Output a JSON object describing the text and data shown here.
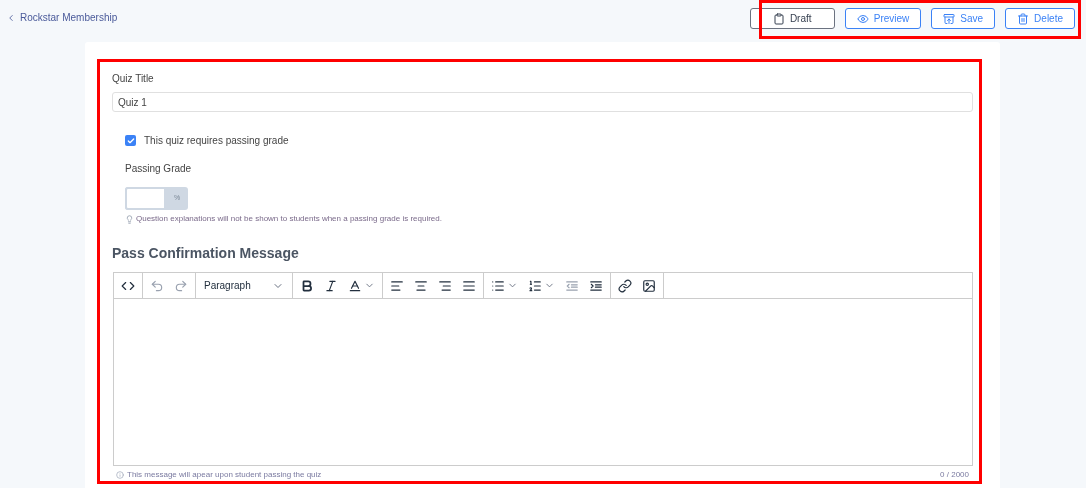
{
  "breadcrumb": {
    "label": "Rockstar Membership"
  },
  "actions": [
    {
      "label": "Draft",
      "kind": "draft"
    },
    {
      "label": "Preview",
      "kind": "preview"
    },
    {
      "label": "Save",
      "kind": "save"
    },
    {
      "label": "Delete",
      "kind": "delete"
    }
  ],
  "quiz_title": {
    "label": "Quiz Title",
    "value": "Quiz 1"
  },
  "passing_grade_required": {
    "label": "This quiz requires passing grade",
    "checked": true
  },
  "passing_grade": {
    "label": "Passing Grade",
    "unit": "%",
    "hint": "Question explanations will not be shown to students when a passing grade is required."
  },
  "pass_message": {
    "heading": "Pass Confirmation Message",
    "toolbar": [
      [
        {
          "kind": "code",
          "disabled": false
        }
      ],
      [
        {
          "kind": "undo",
          "disabled": true
        },
        {
          "kind": "redo",
          "disabled": true
        }
      ],
      [
        {
          "kind": "block-format",
          "label": "Paragraph",
          "disabled": false
        }
      ],
      [
        {
          "kind": "bold",
          "disabled": false
        },
        {
          "kind": "italic",
          "disabled": false
        },
        {
          "kind": "text-color",
          "disabled": false
        }
      ],
      [
        {
          "kind": "align-left",
          "disabled": false
        },
        {
          "kind": "align-center",
          "disabled": false
        },
        {
          "kind": "align-right",
          "disabled": false
        },
        {
          "kind": "align-justify",
          "disabled": false
        }
      ],
      [
        {
          "kind": "bullet-list",
          "disabled": false
        },
        {
          "kind": "numbered-list",
          "disabled": false
        },
        {
          "kind": "outdent",
          "disabled": true
        },
        {
          "kind": "indent",
          "disabled": false
        }
      ],
      [
        {
          "kind": "link",
          "disabled": false
        },
        {
          "kind": "image",
          "disabled": false
        }
      ]
    ],
    "note": "This message will apear upon student passing the quiz",
    "counter": "0 / 2000"
  }
}
